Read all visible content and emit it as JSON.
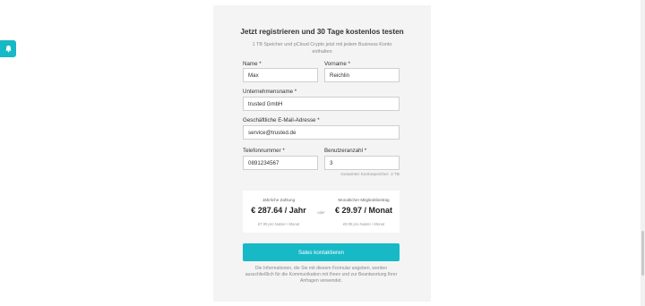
{
  "side_tab": {
    "icon": "bell-icon",
    "color": "#17b9c7"
  },
  "form": {
    "title": "Jetzt registrieren und 30 Tage kostenlos testen",
    "subtitle": "1 TB Speicher und pCloud Crypto jetzt mit jedem Business Konto enthalten",
    "fields": {
      "name": {
        "label": "Name *",
        "value": "Max"
      },
      "vorname": {
        "label": "Vorname *",
        "value": "Reichlin"
      },
      "company": {
        "label": "Unternehmensname *",
        "value": "trusted GmbH"
      },
      "email": {
        "label": "Geschäftliche E-Mail-Adresse *",
        "value": "service@trusted.de"
      },
      "phone": {
        "label": "Telefonnummer *",
        "value": "0891234567"
      },
      "users": {
        "label": "Benutzeranzahl *",
        "value": "3"
      }
    },
    "storage_hint": "Gesamter Kontospeicher: 3 TB",
    "pricing": {
      "yearly": {
        "caption": "Jährliche Zahlung",
        "price": "€ 287.64 / Jahr",
        "note": "€7.99 pro Nutzer / Monat"
      },
      "or_label": "oder",
      "monthly": {
        "caption": "Monatlicher Mitgliedsbeitrag",
        "price": "€ 29.97 / Monat",
        "note": "€9.99 pro Nutzer / Monat"
      }
    },
    "cta_label": "Sales kontaktieren",
    "disclaimer": "Die Informationen, die Sie mit diesem Formular angeben, werden ausschließlich für die Kommunikation mit Ihnen und zur Beantwortung Ihrer Anfragen verwendet.",
    "accent_color": "#17b9c7"
  }
}
